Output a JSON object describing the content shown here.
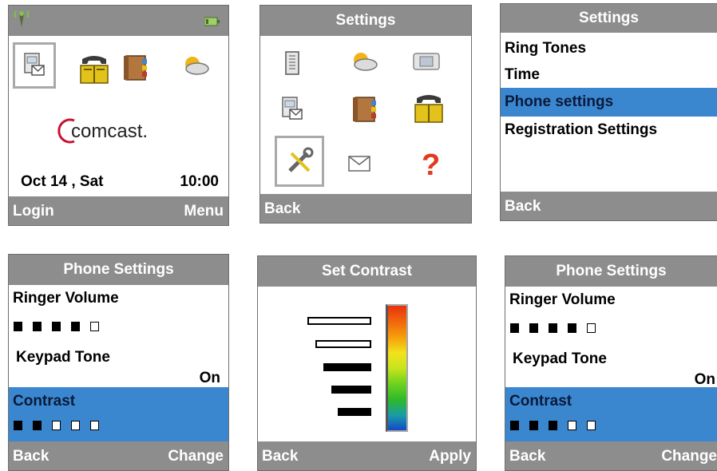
{
  "screen1": {
    "date": "Oct 14 , Sat",
    "time": "10:00",
    "logo": "comcast.",
    "soft_left": "Login",
    "soft_right": "Menu"
  },
  "screen2": {
    "title": "Settings",
    "soft_left": "Back",
    "icons": [
      "phonebook-icon",
      "weather-icon",
      "fax-icon",
      "messages-icon",
      "address-book-icon",
      "phone-directory-icon",
      "tools-icon",
      "mail-icon",
      "help-icon"
    ],
    "selected_icon": "tools-icon"
  },
  "screen3": {
    "title": "Settings",
    "items": [
      "Ring Tones",
      "Time",
      "Phone settings",
      "Registration Settings"
    ],
    "selected_index": 2,
    "soft_left": "Back"
  },
  "screen4": {
    "title": "Phone Settings",
    "ringer_label": "Ringer Volume",
    "ringer_level": 4,
    "keypad_label": "Keypad Tone",
    "keypad_value": "On",
    "contrast_label": "Contrast",
    "contrast_level": 2,
    "soft_left": "Back",
    "soft_right": "Change"
  },
  "screen5": {
    "title": "Set Contrast",
    "contrast_level": 3,
    "soft_left": "Back",
    "soft_right": "Apply"
  },
  "screen6": {
    "title": "Phone Settings",
    "ringer_label": "Ringer Volume",
    "ringer_level": 4,
    "keypad_label": "Keypad Tone",
    "keypad_value": "On",
    "contrast_label": "Contrast",
    "contrast_level": 3,
    "soft_left": "Back",
    "soft_right": "Change"
  },
  "colors": {
    "bar": "#8d8d8d",
    "highlight": "#3b87cf"
  }
}
